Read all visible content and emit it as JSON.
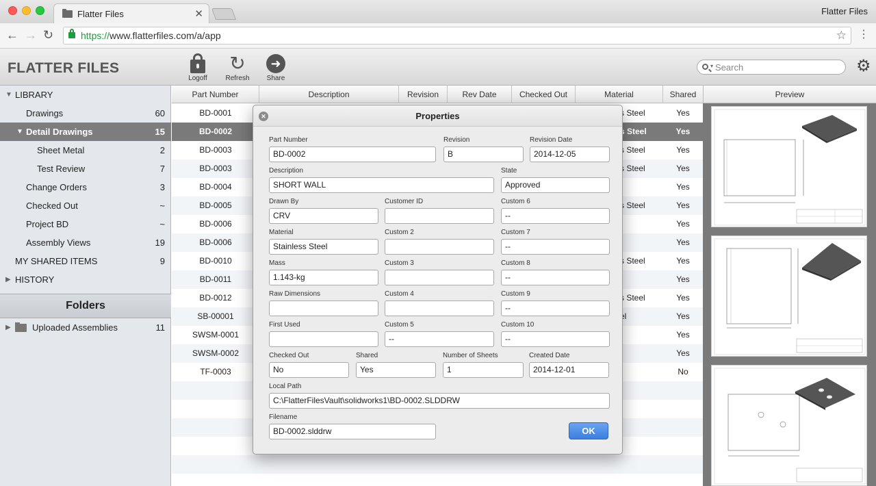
{
  "browser": {
    "tab_title": "Flatter Files",
    "tab_close": "✕",
    "app_label": "Flatter Files",
    "url_scheme": "https://",
    "url_rest": "www.flatterfiles.com/a/app",
    "back": "←",
    "forward": "→",
    "reload": "↻",
    "star": "☆",
    "menu": "⋮"
  },
  "header": {
    "logo": "FLATTER FILES",
    "logoff_label": "Logoff",
    "refresh_label": "Refresh",
    "share_label": "Share",
    "refresh_glyph": "↻",
    "share_glyph": "➜",
    "search_placeholder": "Search",
    "gear_glyph": "⚙"
  },
  "sidebar": {
    "items": [
      {
        "label": "LIBRARY",
        "count": "",
        "tri": "▼"
      },
      {
        "label": "Drawings",
        "count": "60",
        "tri": ""
      },
      {
        "label": "Detail Drawings",
        "count": "15",
        "tri": "▼"
      },
      {
        "label": "Sheet Metal",
        "count": "2",
        "tri": ""
      },
      {
        "label": "Test Review",
        "count": "7",
        "tri": ""
      },
      {
        "label": "Change Orders",
        "count": "3",
        "tri": ""
      },
      {
        "label": "Checked Out",
        "count": "~",
        "tri": ""
      },
      {
        "label": "Project BD",
        "count": "~",
        "tri": ""
      },
      {
        "label": "Assembly Views",
        "count": "19",
        "tri": ""
      },
      {
        "label": "MY SHARED ITEMS",
        "count": "9",
        "tri": ""
      },
      {
        "label": "HISTORY",
        "count": "",
        "tri": "▶"
      }
    ],
    "folders_title": "Folders",
    "folder_item": {
      "label": "Uploaded Assemblies",
      "count": "11",
      "tri": "▶"
    }
  },
  "table": {
    "columns": [
      "Part Number",
      "Description",
      "Revision",
      "Rev Date",
      "Checked Out",
      "Material",
      "Shared"
    ],
    "rows": [
      {
        "pn": "BD-0001",
        "mat": "s Steel",
        "shared": "Yes"
      },
      {
        "pn": "BD-0002",
        "mat": "s Steel",
        "shared": "Yes"
      },
      {
        "pn": "BD-0003",
        "mat": "s Steel",
        "shared": "Yes"
      },
      {
        "pn": "BD-0003",
        "mat": "s Steel",
        "shared": "Yes"
      },
      {
        "pn": "BD-0004",
        "mat": "",
        "shared": "Yes"
      },
      {
        "pn": "BD-0005",
        "mat": "s Steel",
        "shared": "Yes"
      },
      {
        "pn": "BD-0006",
        "mat": "",
        "shared": "Yes"
      },
      {
        "pn": "BD-0006",
        "mat": "",
        "shared": "Yes"
      },
      {
        "pn": "BD-0010",
        "mat": "s Steel",
        "shared": "Yes"
      },
      {
        "pn": "BD-0011",
        "mat": "",
        "shared": "Yes"
      },
      {
        "pn": "BD-0012",
        "mat": "s Steel",
        "shared": "Yes"
      },
      {
        "pn": "SB-00001",
        "mat": "el",
        "shared": "Yes"
      },
      {
        "pn": "SWSM-0001",
        "mat": "",
        "shared": "Yes"
      },
      {
        "pn": "SWSM-0002",
        "mat": "",
        "shared": "Yes"
      },
      {
        "pn": "TF-0003",
        "mat": "",
        "shared": "No"
      }
    ],
    "selected_index": 1
  },
  "preview": {
    "title": "Preview"
  },
  "dialog": {
    "title": "Properties",
    "close_glyph": "✕",
    "ok_label": "OK",
    "fields": {
      "part_number": {
        "label": "Part Number",
        "value": "BD-0002"
      },
      "revision": {
        "label": "Revision",
        "value": "B"
      },
      "revision_date": {
        "label": "Revision Date",
        "value": "2014-12-05"
      },
      "description": {
        "label": "Description",
        "value": "SHORT WALL"
      },
      "state": {
        "label": "State",
        "value": "Approved"
      },
      "drawn_by": {
        "label": "Drawn By",
        "value": "CRV"
      },
      "customer_id": {
        "label": "Customer ID",
        "value": ""
      },
      "custom6": {
        "label": "Custom 6",
        "value": "--"
      },
      "material": {
        "label": "Material",
        "value": "Stainless Steel"
      },
      "custom2": {
        "label": "Custom 2",
        "value": ""
      },
      "custom7": {
        "label": "Custom 7",
        "value": "--"
      },
      "mass": {
        "label": "Mass",
        "value": "1.143-kg"
      },
      "custom3": {
        "label": "Custom 3",
        "value": ""
      },
      "custom8": {
        "label": "Custom 8",
        "value": "--"
      },
      "raw_dimensions": {
        "label": "Raw Dimensions",
        "value": ""
      },
      "custom4": {
        "label": "Custom 4",
        "value": ""
      },
      "custom9": {
        "label": "Custom 9",
        "value": "--"
      },
      "first_used": {
        "label": "First Used",
        "value": ""
      },
      "custom5": {
        "label": "Custom 5",
        "value": "--"
      },
      "custom10": {
        "label": "Custom 10",
        "value": "--"
      },
      "checked_out": {
        "label": "Checked Out",
        "value": "No"
      },
      "shared": {
        "label": "Shared",
        "value": "Yes"
      },
      "number_of_sheets": {
        "label": "Number of Sheets",
        "value": "1"
      },
      "created_date": {
        "label": "Created Date",
        "value": "2014-12-01"
      },
      "local_path": {
        "label": "Local Path",
        "value": "C:\\FlatterFilesVault\\solidworks1\\BD-0002.SLDDRW"
      },
      "filename": {
        "label": "Filename",
        "value": "BD-0002.slddrw"
      }
    }
  }
}
